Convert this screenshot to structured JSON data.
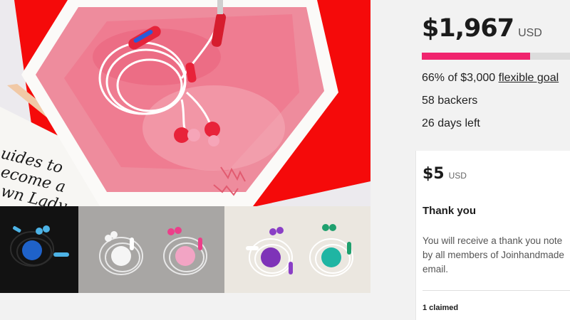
{
  "gallery": {
    "hero_alt": "Earphones on pink watercolor card",
    "card_text": [
      "uides to",
      "ecome a",
      "wn Lady"
    ],
    "thumbnails": [
      {
        "name": "blue-earphones",
        "accent": "#1f62c9"
      },
      {
        "name": "white-pink-earphones",
        "accent": "#f2a4c4"
      },
      {
        "name": "purple-teal-earphones",
        "accent": "#7e33b8"
      }
    ]
  },
  "funding": {
    "amount": "$1,967",
    "currency": "USD",
    "progress": 0.66,
    "goal_prefix": "66% of $3,000 ",
    "goal_link": "flexible goal",
    "backers": "58 backers",
    "days_left": "26 days left"
  },
  "reward": {
    "price": "$5",
    "currency": "USD",
    "title": "Thank you",
    "description_lines": [
      "You will receive a thank you note",
      "by all members of Joinhandmade",
      "email."
    ],
    "claimed": "1 claimed"
  },
  "colors": {
    "accent": "#f0246e",
    "progress_track": "#dcdcdc",
    "red_backdrop": "#ff0000"
  }
}
